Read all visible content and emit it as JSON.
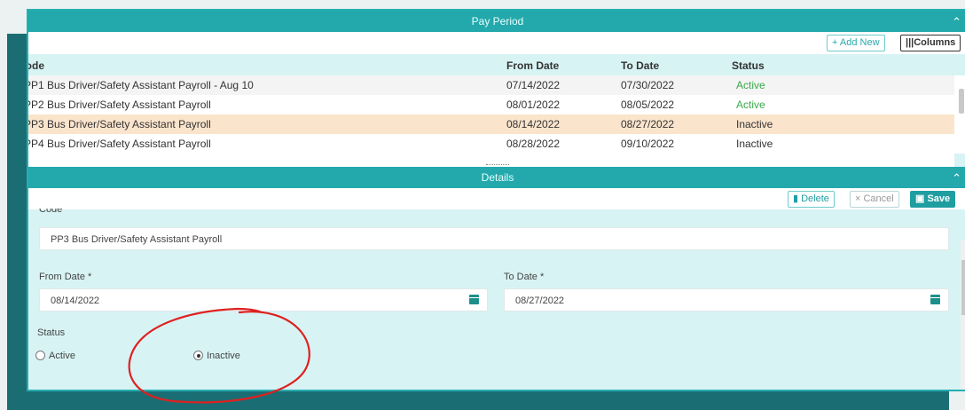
{
  "pay_period": {
    "title": "Pay Period",
    "add_new_label": "+ Add New",
    "columns_label": "|||Columns",
    "headers": {
      "code": "Code",
      "from": "From Date",
      "to": "To Date",
      "status": "Status"
    },
    "rows": [
      {
        "code": "PP1 Bus Driver/Safety Assistant Payroll - Aug 10",
        "from": "07/14/2022",
        "to": "07/30/2022",
        "status": "Active"
      },
      {
        "code": "PP2 Bus Driver/Safety Assistant Payroll",
        "from": "08/01/2022",
        "to": "08/05/2022",
        "status": "Active"
      },
      {
        "code": "PP3 Bus Driver/Safety Assistant Payroll",
        "from": "08/14/2022",
        "to": "08/27/2022",
        "status": "Inactive"
      },
      {
        "code": "PP4 Bus Driver/Safety Assistant Payroll",
        "from": "08/28/2022",
        "to": "09/10/2022",
        "status": "Inactive"
      }
    ]
  },
  "details": {
    "title": "Details",
    "delete_label": "Delete",
    "cancel_label": "× Cancel",
    "save_label": "Save",
    "code_label": "Code",
    "code_value": "PP3  Bus Driver/Safety Assistant Payroll",
    "from_label": "From Date *",
    "from_value": "08/14/2022",
    "to_label": "To Date *",
    "to_value": "08/27/2022",
    "status_label": "Status",
    "status_options": [
      "Active",
      "Inactive"
    ],
    "status_selected": "Inactive"
  },
  "colors": {
    "accent": "#23a9ac",
    "panel": "#d8f3f4",
    "selected_row": "#fbe4cc",
    "active_status": "#3aa94a",
    "annotation": "#e02020"
  }
}
